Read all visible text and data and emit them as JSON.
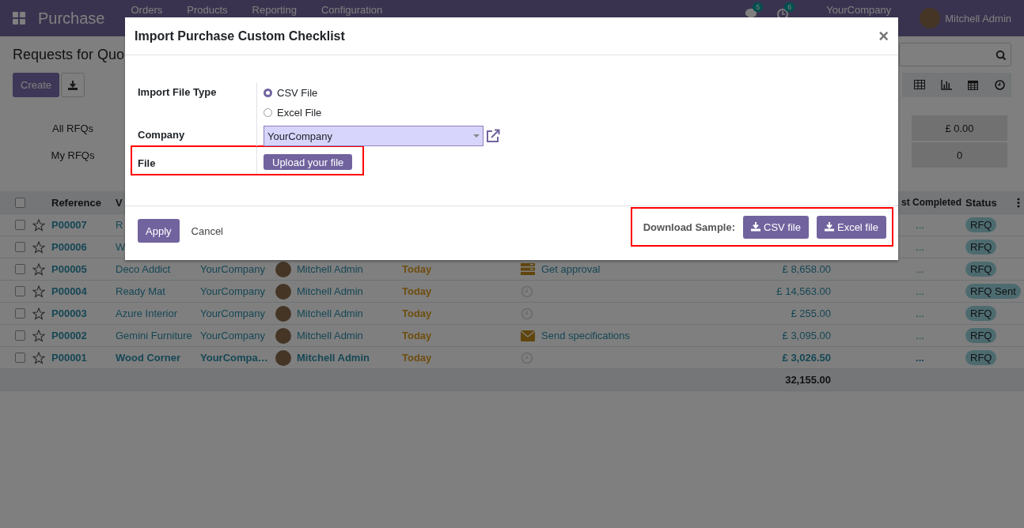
{
  "navbar": {
    "app_title": "Purchase",
    "menu": [
      "Orders",
      "Products",
      "Reporting",
      "Configuration"
    ],
    "systray": [
      {
        "kind": "chat",
        "count": "5"
      },
      {
        "kind": "activity",
        "count": "6"
      }
    ],
    "company": "YourCompany",
    "user": "Mitchell Admin"
  },
  "control_panel": {
    "title": "Requests for Quo",
    "create": "Create",
    "views": [
      {
        "kind": "table",
        "selected": false
      },
      {
        "kind": "graph",
        "selected": false
      },
      {
        "kind": "calendar",
        "selected": false
      },
      {
        "kind": "activity",
        "selected": false
      }
    ],
    "dashboard": [
      {
        "label": "All RFQs",
        "value": "£ 0.00"
      },
      {
        "label": "My RFQs",
        "value": "0"
      }
    ]
  },
  "table": {
    "columns": [
      "Reference",
      "V",
      "st Completed",
      "Status"
    ],
    "select_all_checked": false,
    "rows": [
      {
        "checked": false,
        "reference": "P00007",
        "vendor": "R",
        "last_completed": "...",
        "status": "RFQ",
        "bold": false
      },
      {
        "checked": false,
        "reference": "P00006",
        "vendor": "W",
        "last_completed": "...",
        "status": "RFQ",
        "bold": false
      },
      {
        "checked": false,
        "reference": "P00005",
        "vendor": "Deco Addict",
        "company": "YourCompany",
        "buyer": "Mitchell Admin",
        "date": "Today",
        "activity": {
          "kind": "todo",
          "text": "Get approval"
        },
        "amount": "£ 8,658.00",
        "last_completed": "...",
        "status": "RFQ",
        "bold": false
      },
      {
        "checked": false,
        "reference": "P00004",
        "vendor": "Ready Mat",
        "company": "YourCompany",
        "buyer": "Mitchell Admin",
        "date": "Today",
        "activity": {
          "kind": "none"
        },
        "amount": "£ 14,563.00",
        "last_completed": "...",
        "status": "RFQ Sent",
        "bold": false
      },
      {
        "checked": false,
        "reference": "P00003",
        "vendor": "Azure Interior",
        "company": "YourCompany",
        "buyer": "Mitchell Admin",
        "date": "Today",
        "activity": {
          "kind": "none"
        },
        "amount": "£ 255.00",
        "last_completed": "...",
        "status": "RFQ",
        "bold": false
      },
      {
        "checked": false,
        "reference": "P00002",
        "vendor": "Gemini Furniture",
        "company": "YourCompany",
        "buyer": "Mitchell Admin",
        "date": "Today",
        "activity": {
          "kind": "email",
          "text": "Send specifications"
        },
        "amount": "£ 3,095.00",
        "last_completed": "...",
        "status": "RFQ",
        "bold": false
      },
      {
        "checked": false,
        "reference": "P00001",
        "vendor": "Wood Corner",
        "company": "YourCompa…",
        "buyer": "Mitchell Admin",
        "date": "Today",
        "activity": {
          "kind": "none"
        },
        "amount": "£ 3,026.50",
        "last_completed": "...",
        "status": "RFQ",
        "bold": true
      }
    ],
    "total": "32,155.00"
  },
  "dialog": {
    "title": "Import Purchase Custom Checklist",
    "close": "×",
    "fields": [
      {
        "kind": "radio",
        "label": "Import File Type",
        "options": [
          {
            "label": "CSV File",
            "selected": true
          },
          {
            "label": "Excel File",
            "selected": false
          }
        ]
      },
      {
        "kind": "select",
        "label": "Company",
        "value": "YourCompany"
      },
      {
        "kind": "upload",
        "label": "File",
        "button": "Upload your file",
        "highlighted": true
      }
    ],
    "footer": {
      "apply": "Apply",
      "cancel": "Cancel",
      "download_label": "Download Sample:",
      "downloads": [
        "CSV file",
        "Excel file"
      ],
      "highlighted": true
    }
  }
}
